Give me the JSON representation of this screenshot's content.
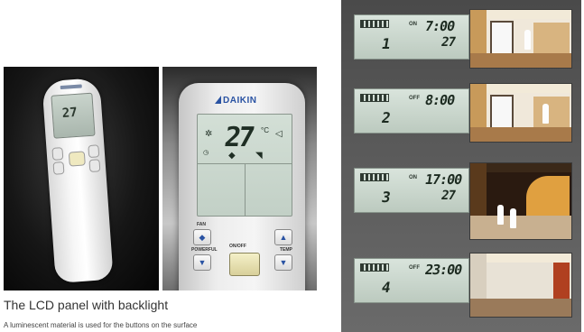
{
  "brand": "DAIKIN",
  "caption": {
    "title": "The LCD panel with backlight",
    "subtitle": "A luminescent material is used for the buttons on the surface"
  },
  "remote_display": {
    "temperature": "27"
  },
  "remote_buttons": {
    "fan": "FAN",
    "onoff": "ON/OFF",
    "powerful": "POWERFUL",
    "temp": "TEMP"
  },
  "timers": [
    {
      "program": "1",
      "time": "7:00",
      "temp": "27"
    },
    {
      "program": "2",
      "time": "8:00",
      "temp": ""
    },
    {
      "program": "3",
      "time": "17:00",
      "temp": "27"
    },
    {
      "program": "4",
      "time": "23:00",
      "temp": ""
    }
  ],
  "colors": {
    "brand_blue": "#2a53a3",
    "lcd_green": "#c2d0c6",
    "onoff_button": "#d8d09a"
  }
}
